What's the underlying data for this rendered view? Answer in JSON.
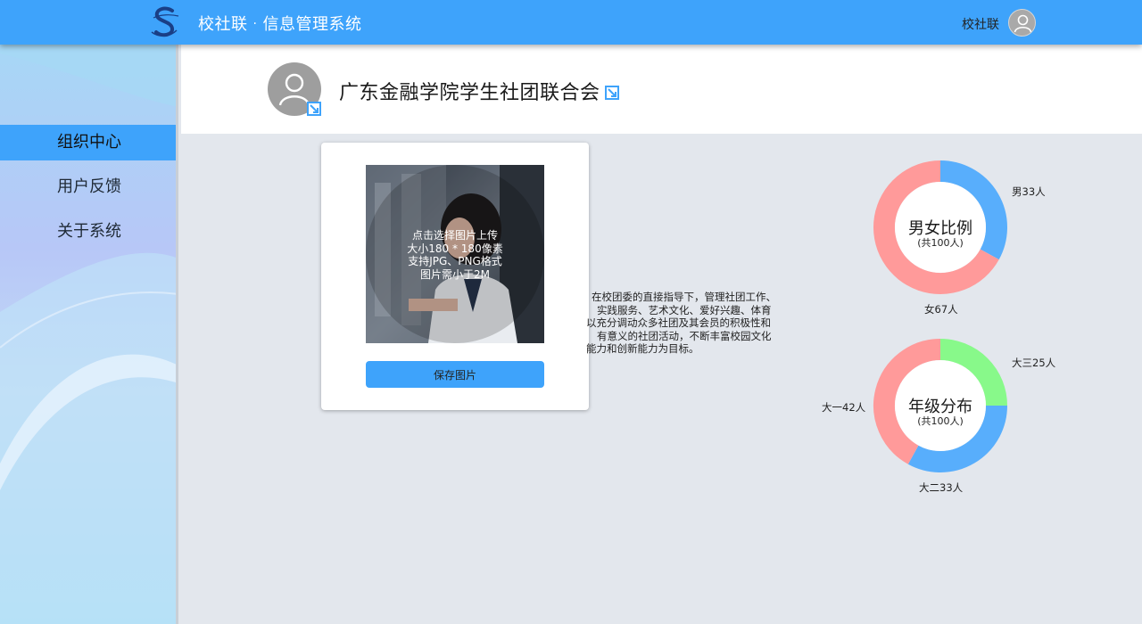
{
  "header": {
    "app_name": "校社联",
    "separator": "·",
    "system_name": "信息管理系统",
    "username": "校社联",
    "logo_icon": "s-logo-icon",
    "avatar_icon": "user-icon"
  },
  "sidebar": {
    "items": [
      {
        "label": "组织中心",
        "active": true
      },
      {
        "label": "用户反馈",
        "active": false
      },
      {
        "label": "关于系统",
        "active": false
      }
    ]
  },
  "organization": {
    "name": "广东金融学院学生社团联合会",
    "edit_icon": "edit-icon"
  },
  "upload": {
    "hint_lines": [
      "点击选择图片上传",
      "大小180 * 180像素",
      "支持JPG、PNG格式",
      "图片需小于2M"
    ],
    "save_label": "保存图片"
  },
  "description": {
    "lines": [
      "在校团委的直接指导下，管理社团工作、",
      "实践服务、艺术文化、爱好兴趣、体育",
      "以充分调动众多社团及其会员的积极性和",
      "有意义的社团活动，不断丰富校园文化",
      "能力和创新能力为目标。"
    ]
  },
  "colors": {
    "primary": "#3ea3fb",
    "male": "#58aefc",
    "female": "#ff9a9a",
    "grade3": "#88f98a"
  },
  "chart_data": [
    {
      "type": "pie",
      "title": "男女比例",
      "subtitle": "(共100人)",
      "categories": [
        "男",
        "女"
      ],
      "values": [
        33,
        67
      ],
      "labels": [
        "男33人",
        "女67人"
      ]
    },
    {
      "type": "pie",
      "title": "年级分布",
      "subtitle": "(共100人)",
      "categories": [
        "大三",
        "大二",
        "大一"
      ],
      "values": [
        25,
        33,
        42
      ],
      "labels": [
        "大三25人",
        "大二33人",
        "大一42人"
      ]
    }
  ]
}
